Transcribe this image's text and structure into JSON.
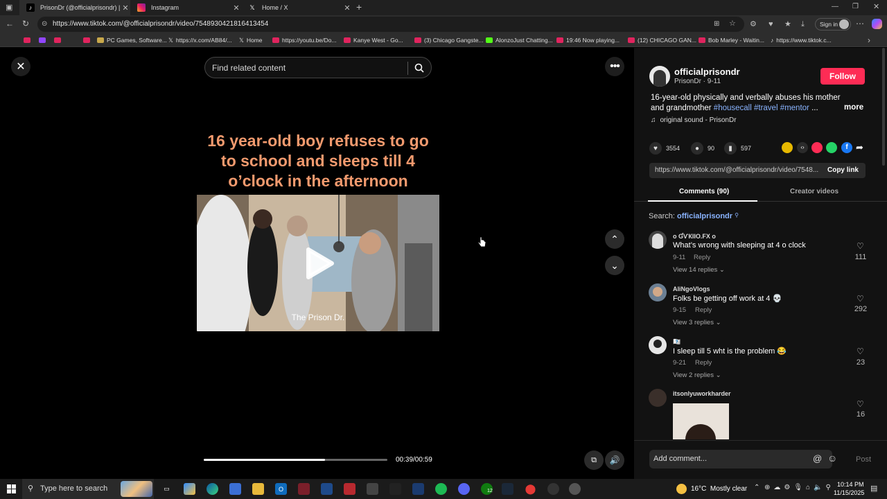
{
  "browser": {
    "tabs": [
      {
        "title": "PrisonDr (@officialprisondr) | TikT",
        "icon": "tiktok-icon",
        "active": true
      },
      {
        "title": "Instagram",
        "icon": "instagram-icon",
        "active": false
      },
      {
        "title": "Home / X",
        "icon": "x-icon",
        "active": false
      }
    ],
    "url": "https://www.tiktok.com/@officialprisondr/video/7548930421816413454",
    "sign_in": "Sign in",
    "bookmarks": [
      {
        "label": "",
        "icon": "youtube-icon"
      },
      {
        "label": "",
        "icon": "twitch-icon"
      },
      {
        "label": "",
        "icon": "youtube-icon"
      },
      {
        "label": "",
        "icon": "youtube-icon"
      },
      {
        "label": "PC Games, Software...",
        "icon": "games-icon"
      },
      {
        "label": "https://x.com/AB84/...",
        "icon": "x-icon"
      },
      {
        "label": "Home",
        "icon": "x-icon"
      },
      {
        "label": "https://youtu.be/Do...",
        "icon": "youtube-icon"
      },
      {
        "label": "Kanye West - Go...",
        "icon": "youtube-icon"
      },
      {
        "label": "(3) Chicago Gangste...",
        "icon": "youtube-icon"
      },
      {
        "label": "AlonzoJust Chatting...",
        "icon": "kick-icon"
      },
      {
        "label": "19:46 Now playing...",
        "icon": "youtube-icon"
      },
      {
        "label": "(12) CHICAGO GAN...",
        "icon": "youtube-icon"
      },
      {
        "label": "Bob Marley - Waitin...",
        "icon": "youtube-icon"
      },
      {
        "label": "https://www.tiktok.c...",
        "icon": "tiktok-icon"
      }
    ]
  },
  "video": {
    "search_placeholder": "Find related content",
    "caption": "16 year-old boy refuses to go to school and sleeps till 4 o’clock in the afternoon",
    "watermark": "The Prison Dr.",
    "time": "00:39/00:59",
    "progress": 0.66
  },
  "author": {
    "username": "officialprisondr",
    "subtitle": "PrisonDr · 9-11",
    "follow": "Follow"
  },
  "description": {
    "text": "16-year-old physically and verbally abuses his mother and grandmother",
    "hashtags": "#housecall #travel #mentor",
    "ellipsis": "...",
    "more": "more",
    "sound": "original sound - PrisonDr"
  },
  "stats": {
    "likes": "3554",
    "comments": "90",
    "saves": "597"
  },
  "link": {
    "url": "https://www.tiktok.com/@officialprisondr/video/7548...",
    "copy": "Copy link"
  },
  "tabs": {
    "comments": "Comments (90)",
    "creator": "Creator videos"
  },
  "search_line": {
    "label": "Search:",
    "term": "officialprisondr"
  },
  "comments": [
    {
      "name": "ο ƓѴКІІО.FX ο",
      "text": "What’s wrong with sleeping at 4 o clock",
      "date": "9-11",
      "reply": "Reply",
      "replies": "View 14 replies",
      "likes": "111"
    },
    {
      "name": "AliNgoVlogs",
      "text": "Folks be getting off work at 4 💀",
      "date": "9-15",
      "reply": "Reply",
      "replies": "View 3 replies",
      "likes": "292"
    },
    {
      "name": "🇽🇽",
      "text": "I sleep till 5 wht is the problem 😂",
      "date": "9-21",
      "reply": "Reply",
      "replies": "View 2 replies",
      "likes": "23"
    },
    {
      "name": "itsonlyuworkharder",
      "text": "",
      "date": "",
      "reply": "",
      "replies": "",
      "likes": "16"
    }
  ],
  "add_comment": {
    "placeholder": "Add comment...",
    "post": "Post"
  },
  "taskbar": {
    "search_placeholder": "Type here to search",
    "weather": "16°C  Mostly clear",
    "time": "10:14 PM",
    "date": "11/15/2025",
    "badge": "12"
  }
}
